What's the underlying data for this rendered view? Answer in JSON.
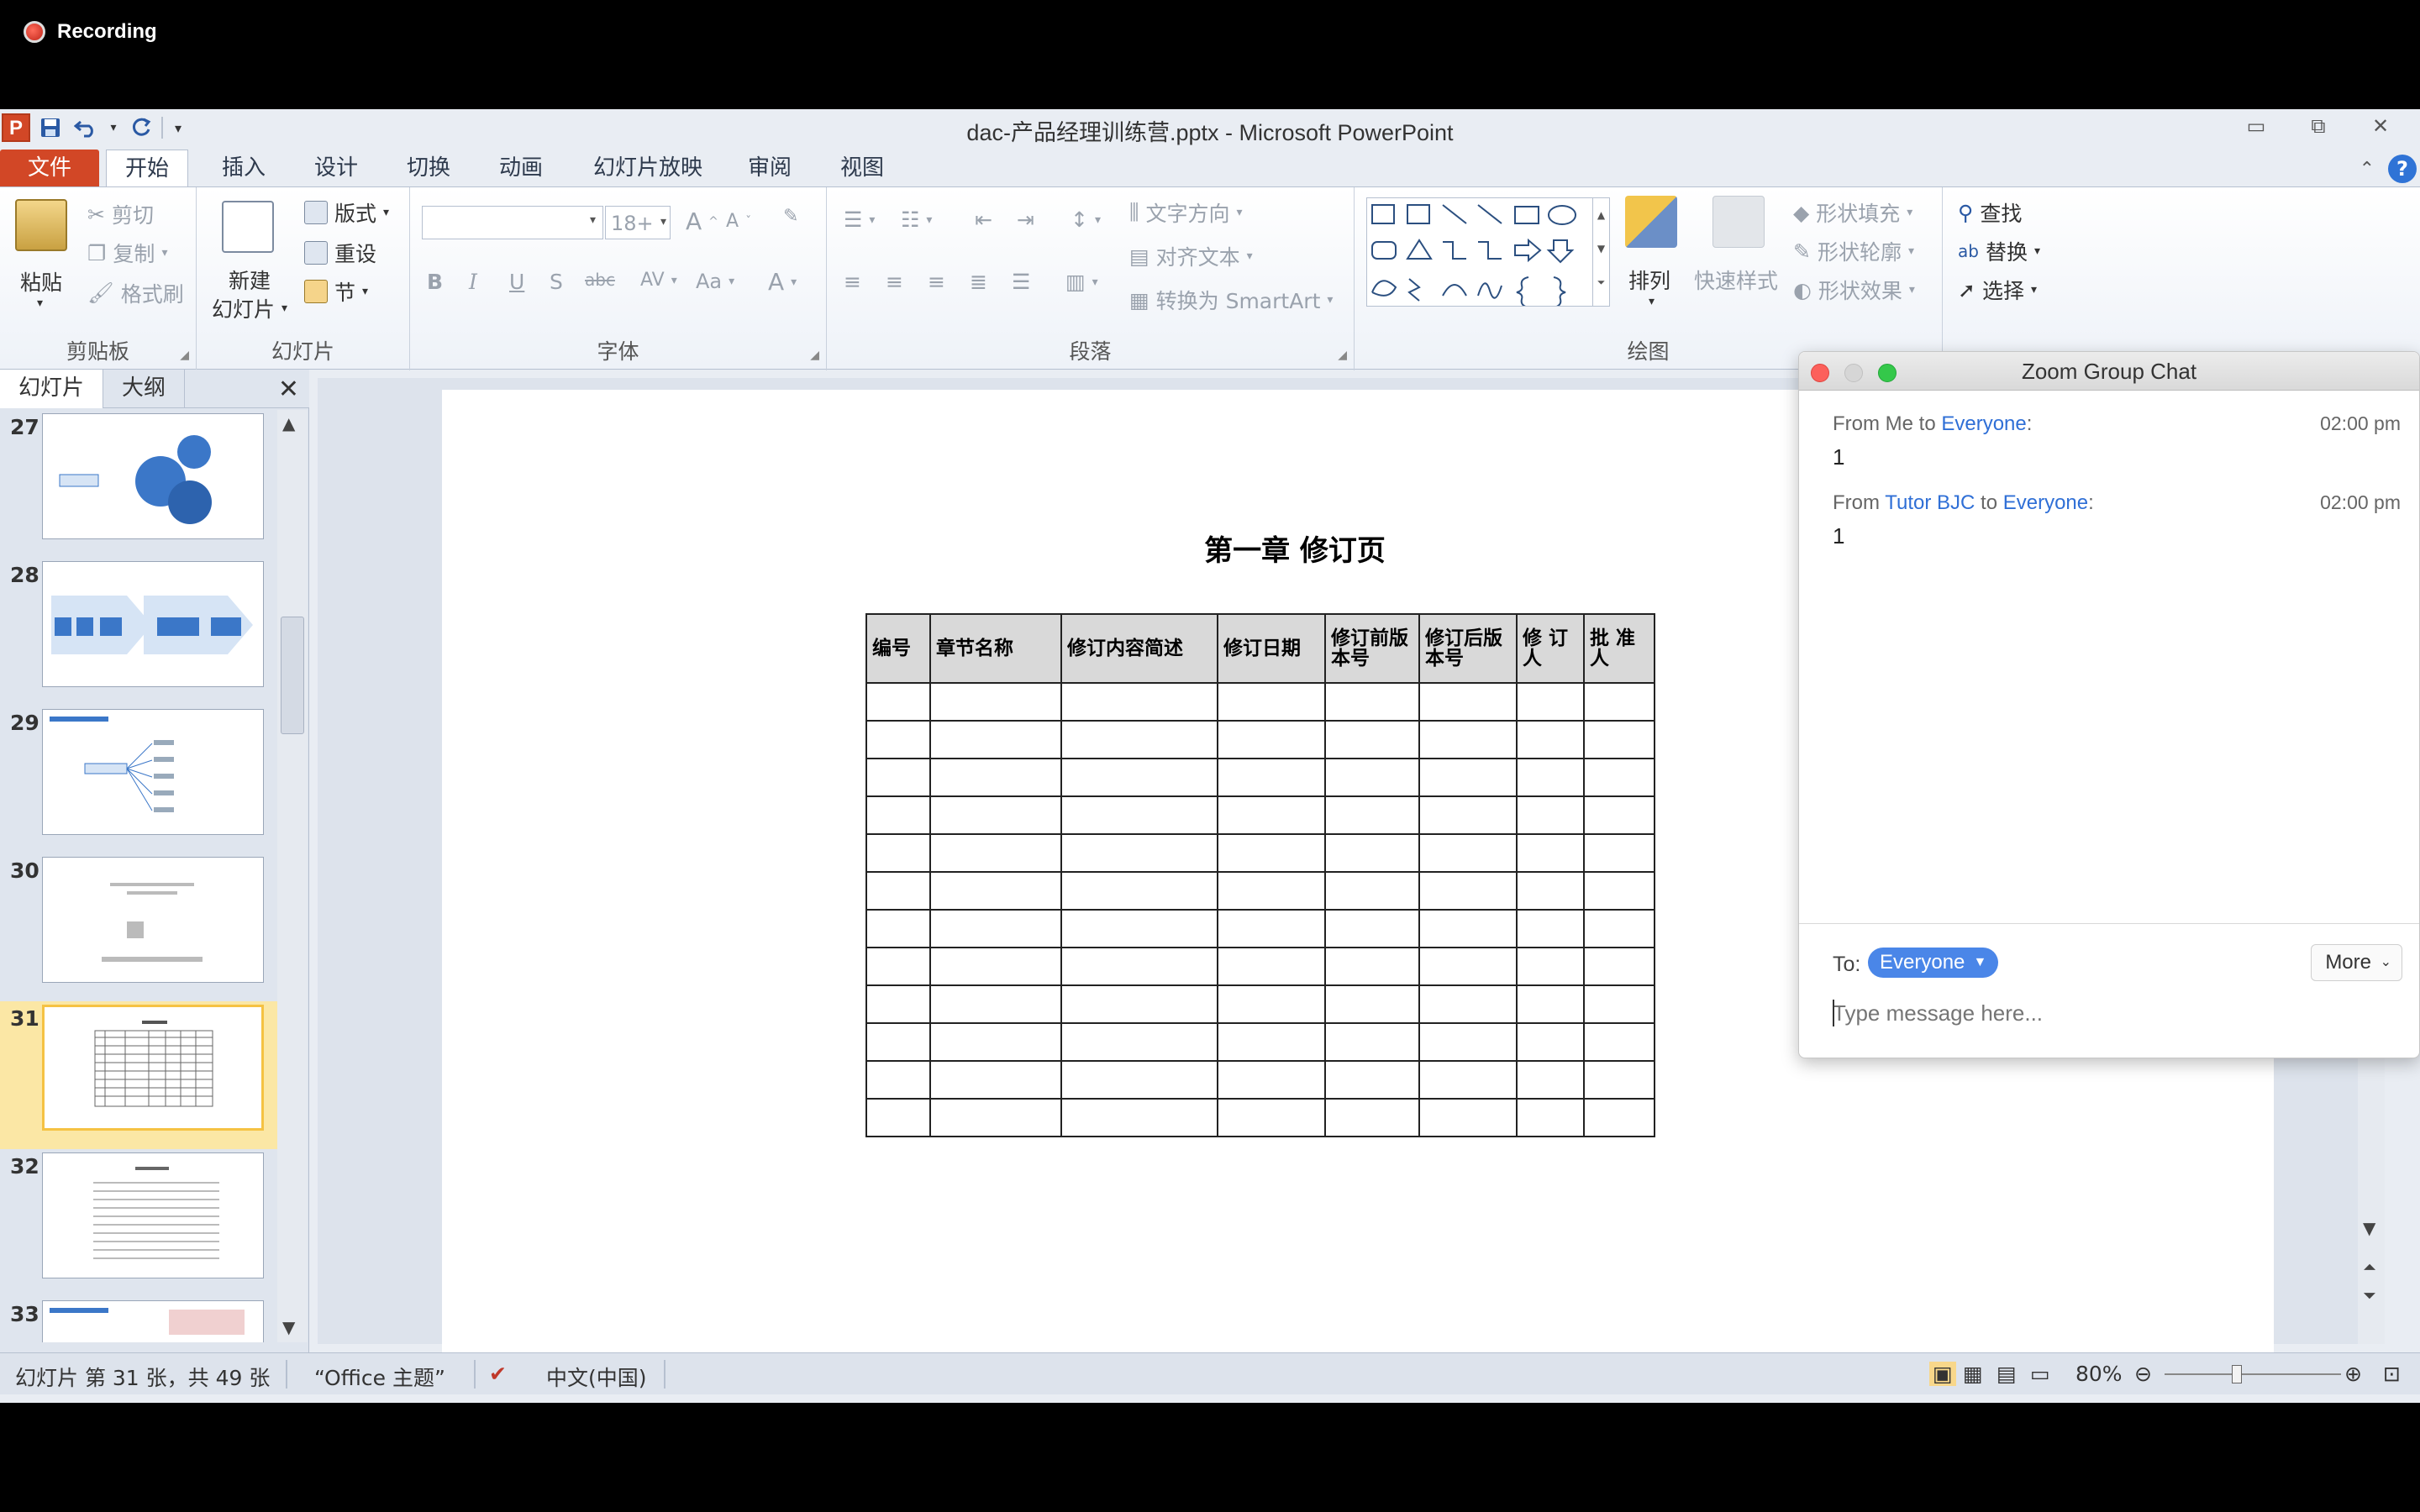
{
  "recording": {
    "label": "Recording"
  },
  "window": {
    "title": "dac-产品经理训练营.pptx - Microsoft PowerPoint",
    "logo_letter": "P"
  },
  "tabs": [
    "文件",
    "开始",
    "插入",
    "设计",
    "切换",
    "动画",
    "幻灯片放映",
    "审阅",
    "视图"
  ],
  "ribbon": {
    "clipboard": {
      "paste": "粘贴",
      "cut": "剪切",
      "copy": "复制",
      "format_painter": "格式刷",
      "label": "剪贴板"
    },
    "slides": {
      "new_slide_1": "新建",
      "new_slide_2": "幻灯片",
      "layout": "版式",
      "reset": "重设",
      "section": "节",
      "label": "幻灯片"
    },
    "font": {
      "size": "18+",
      "bold": "B",
      "italic": "I",
      "underline": "U",
      "shadow": "S",
      "strike": "abc",
      "spacing": "AV",
      "case": "Aa",
      "color": "A",
      "grow": "A",
      "shrink": "A",
      "label": "字体"
    },
    "paragraph": {
      "text_dir": "文字方向",
      "align_text": "对齐文本",
      "smartart": "转换为 SmartArt",
      "label": "段落"
    },
    "drawing": {
      "arrange": "排列",
      "quick_styles": "快速样式",
      "shape_fill": "形状填充",
      "shape_outline": "形状轮廓",
      "shape_effects": "形状效果",
      "label": "绘图"
    },
    "editing": {
      "find": "查找",
      "replace": "替换",
      "select": "选择"
    }
  },
  "left_panel": {
    "tabs": [
      "幻灯片",
      "大纲"
    ],
    "slides": [
      {
        "num": "27"
      },
      {
        "num": "28"
      },
      {
        "num": "29"
      },
      {
        "num": "30"
      },
      {
        "num": "31"
      },
      {
        "num": "32"
      },
      {
        "num": "33"
      }
    ],
    "selected": "31"
  },
  "slide": {
    "title": "第一章  修订页",
    "headers": [
      "编号",
      "章节名称",
      "修订内容简述",
      "修订日期",
      "修订前版本号",
      "修订后版本号",
      "修 订人",
      "批 准人"
    ],
    "empty_rows": 12
  },
  "status": {
    "slide_info": "幻灯片 第 31 张，共 49 张",
    "theme": "“Office 主题”",
    "language": "中文(中国)",
    "zoom": "80%"
  },
  "chat": {
    "title": "Zoom Group Chat",
    "messages": [
      {
        "from_prefix": "From Me to ",
        "from_name": "",
        "to_sep": "",
        "to": "Everyone",
        "colon": ":",
        "time": "02:00 pm",
        "text": "1"
      },
      {
        "from_prefix": "From ",
        "from_name": "Tutor BJC",
        "to_sep": " to ",
        "to": "Everyone",
        "colon": ":",
        "time": "02:00 pm",
        "text": "1"
      }
    ],
    "to_label": "To:",
    "to_value": "Everyone",
    "more": "More",
    "placeholder": "Type message here..."
  },
  "colors": {
    "file_tab": "#d24726",
    "chat_blue": "#2f6fd6",
    "selected_slide": "#fbe7a5"
  }
}
